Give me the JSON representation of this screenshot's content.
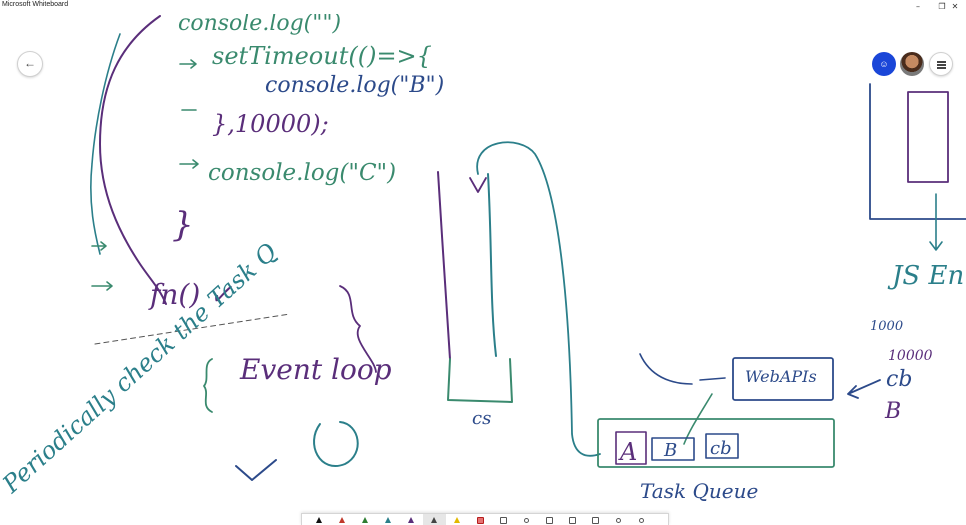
{
  "window": {
    "title": "Microsoft Whiteboard",
    "minimize_glyph": "–",
    "maximize_glyph": "❐",
    "close_glyph": "✕"
  },
  "header": {
    "back_glyph": "←",
    "user_initial_glyph": "☺"
  },
  "colors": {
    "green_ink": "#3a8a6e",
    "purple_ink": "#5a2e7a",
    "teal_ink": "#2b7f8a",
    "blue_ink": "#2c4a8a",
    "avatar_blue": "#1a46d8"
  },
  "canvas": {
    "code": {
      "line1": "console.log(\"\")",
      "line2": "setTimeout(()=>{",
      "line3": "console.log(\"B\")",
      "line4": "},10000);",
      "line5": "console.log(\"C\")",
      "close_brace": "}"
    },
    "fn_call": "fn() ✓",
    "event_loop": "Event loop",
    "periodically": "Periodically check the Task Q",
    "stack_label": "cs",
    "webapis_label": "WebAPIs",
    "cb_label": "cb",
    "b_label": "B",
    "timer_values": [
      "10000",
      "1000"
    ],
    "js_engine_label": "JS En",
    "task_queue": {
      "label": "Task Queue",
      "items": [
        "A",
        "B",
        "cb"
      ]
    }
  },
  "toolbar": {
    "tools": [
      "pen-black",
      "pen-red",
      "pen-green",
      "pen-teal",
      "pen-purple",
      "pen-dark",
      "pen-selected",
      "highlighter",
      "eraser",
      "ruler",
      "lasso",
      "image",
      "note",
      "text",
      "shape",
      "undo",
      "redo"
    ]
  }
}
